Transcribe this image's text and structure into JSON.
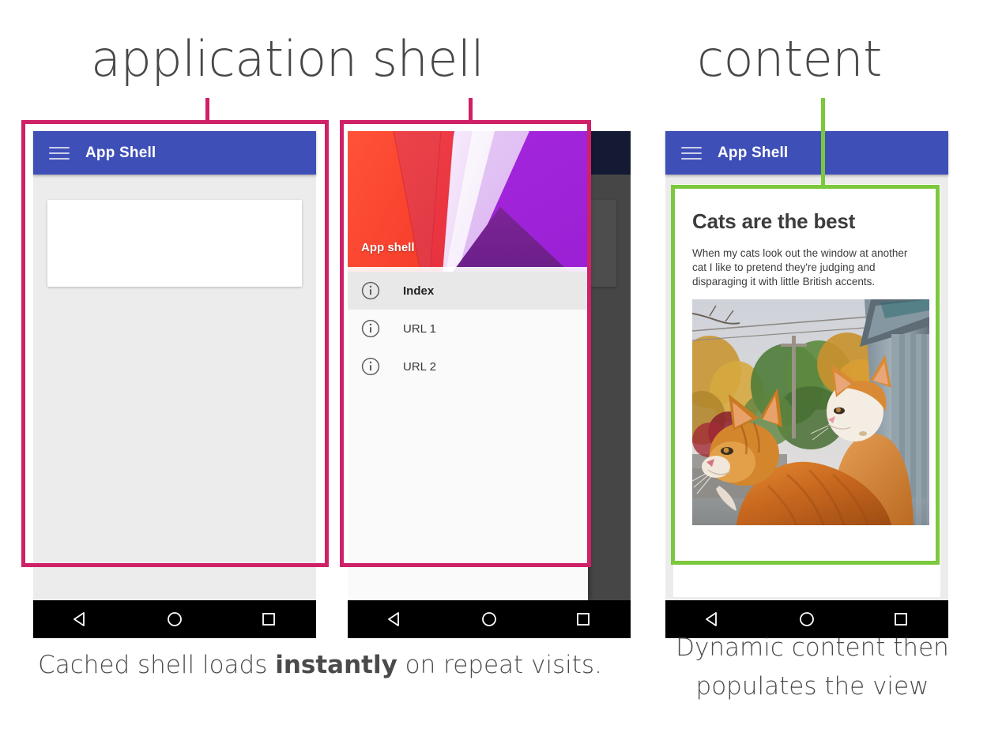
{
  "annotations": {
    "app_shell_label": "application shell",
    "content_label": "content",
    "pink_color": "#CE2167",
    "green_color": "#7CC83C"
  },
  "captions": {
    "left_prefix": "Cached shell loads ",
    "left_bold": "instantly",
    "left_suffix": " on repeat visits.",
    "right_line_1": "Dynamic content then",
    "right_line_2": "populates the view"
  },
  "phones": {
    "phone1": {
      "appbar": {
        "title": "App Shell",
        "menu_icon": "hamburger-menu-icon",
        "color": "#3F4FB8"
      },
      "skeleton_placeholder": "",
      "navbar": {
        "back": "back-triangle-icon",
        "home": "home-circle-icon",
        "recents": "recents-square-icon"
      }
    },
    "phone2": {
      "appbar": {
        "title": "App Shell",
        "menu_icon": "hamburger-menu-icon",
        "color": "#3F4FB8"
      },
      "drawer": {
        "hero_label": "App shell",
        "items": [
          {
            "label": "Index",
            "icon": "info-circle-icon",
            "active": true
          },
          {
            "label": "URL 1",
            "icon": "info-circle-icon",
            "active": false
          },
          {
            "label": "URL 2",
            "icon": "info-circle-icon",
            "active": false
          }
        ]
      },
      "navbar": {
        "back": "back-triangle-icon",
        "home": "home-circle-icon",
        "recents": "recents-square-icon"
      }
    },
    "phone3": {
      "appbar": {
        "title": "App Shell",
        "menu_icon": "hamburger-menu-icon",
        "color": "#3F4FB8"
      },
      "article": {
        "heading": "Cats are the best",
        "body": "When my cats look out the window at another cat I like to pretend they're judging and disparaging it with little British accents.",
        "photo_alt": "two-orange-cats-looking-out-window"
      },
      "navbar": {
        "back": "back-triangle-icon",
        "home": "home-circle-icon",
        "recents": "recents-square-icon"
      }
    }
  }
}
